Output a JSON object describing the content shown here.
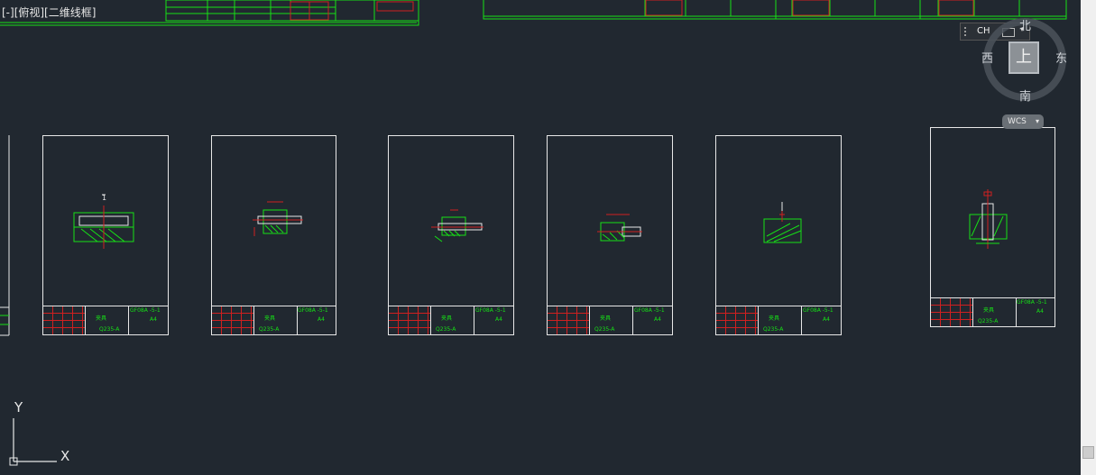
{
  "view_label": "[-][俯视][二维线框]",
  "nav_cube": {
    "face": "上",
    "north": "北",
    "south": "南",
    "west": "西",
    "east": "东"
  },
  "ime_bar": {
    "label": "CH"
  },
  "wcs_label": "WCS",
  "ucs_axes": {
    "y": "Y",
    "x": "X"
  },
  "sheets": [
    {
      "title_text": "1",
      "name": "夹具",
      "code": "GF08A -5-1",
      "sub": "A4",
      "part": "Q235-A"
    },
    {
      "title_text": "",
      "name": "夹具",
      "code": "GF08A -5-1",
      "sub": "A4",
      "part": "Q235-A"
    },
    {
      "title_text": "",
      "name": "夹具",
      "code": "GF08A -5-1",
      "sub": "A4",
      "part": "Q235-A"
    },
    {
      "title_text": "",
      "name": "夹具",
      "code": "GF08A -5-1",
      "sub": "A4",
      "part": "Q235-A"
    },
    {
      "title_text": "",
      "name": "夹具",
      "code": "GF08A -5-1",
      "sub": "A4",
      "part": "Q235-A"
    },
    {
      "title_text": "",
      "name": "夹具",
      "code": "GF08A -5-1",
      "sub": "A4",
      "part": "Q235-A"
    }
  ],
  "colors": {
    "background": "#212830",
    "green": "#16e016",
    "red": "#d02020",
    "white": "#e8e8e8"
  }
}
